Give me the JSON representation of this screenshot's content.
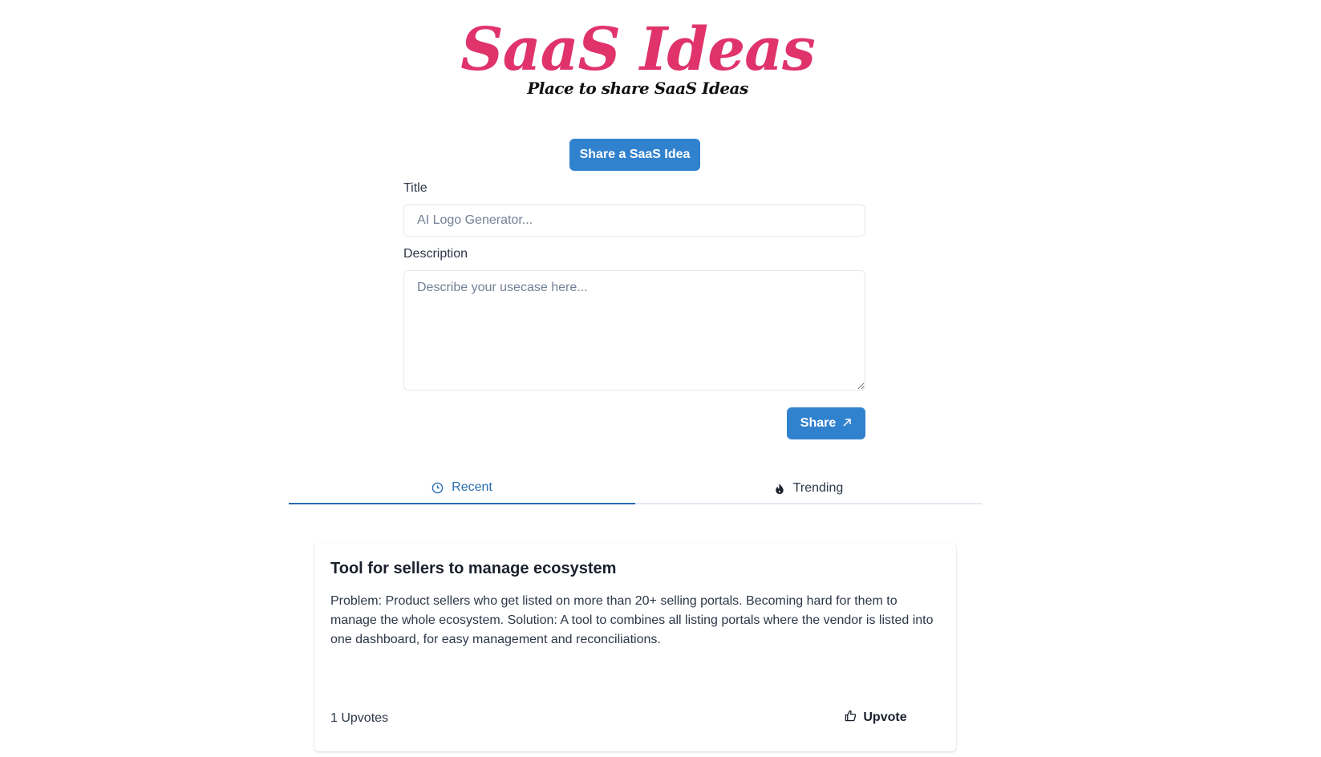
{
  "brand": {
    "title": "SaaS Ideas",
    "subtitle": "Place to share SaaS Ideas",
    "title_color": "#e0336b"
  },
  "form": {
    "open_button_label": "Share a SaaS Idea",
    "title_label": "Title",
    "title_placeholder": "AI Logo Generator...",
    "title_value": "",
    "description_label": "Description",
    "description_placeholder": "Describe your usecase here...",
    "description_value": "",
    "submit_label": "Share",
    "submit_icon": "arrow-up-right-icon"
  },
  "tabs": [
    {
      "label": "Recent",
      "icon": "clock-icon",
      "active": true
    },
    {
      "label": "Trending",
      "icon": "flame-icon",
      "active": false
    }
  ],
  "ideas": [
    {
      "title": "Tool for sellers to manage ecosystem",
      "description": "Problem: Product sellers who get listed on more than 20+ selling portals. Becoming hard for them to manage the whole ecosystem. Solution: A tool to combines all listing portals where the vendor is listed into one dashboard, for easy management and reconciliations.",
      "upvotes_text": "1 Upvotes",
      "upvote_button_label": "Upvote",
      "upvote_icon": "thumbs-up-icon"
    }
  ],
  "colors": {
    "primary": "#3182ce",
    "tab_active": "#2b6cb0"
  }
}
